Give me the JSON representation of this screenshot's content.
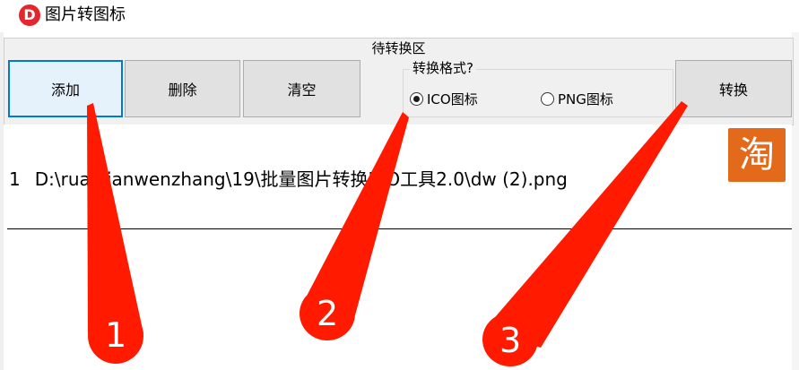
{
  "window": {
    "title": "图片转图标",
    "app_icon_letter": "D"
  },
  "panel": {
    "title": "待转换区"
  },
  "buttons": {
    "add": "添加",
    "delete": "删除",
    "clear": "清空",
    "convert": "转换"
  },
  "format_group": {
    "legend": "转换格式?",
    "options": [
      {
        "label": "ICO图标",
        "selected": true
      },
      {
        "label": "PNG图标",
        "selected": false
      }
    ]
  },
  "file_list": {
    "rows": [
      {
        "index": "1",
        "path": "D:\\ruanjianwenzhang\\19\\批量图片转换ICO工具2.0\\dw (2).png"
      }
    ]
  },
  "badge": {
    "text": "淘",
    "color": "#e36a1b"
  },
  "annotations": {
    "labels": [
      "1",
      "2",
      "3"
    ],
    "arrow_color": "#ff1a00"
  }
}
